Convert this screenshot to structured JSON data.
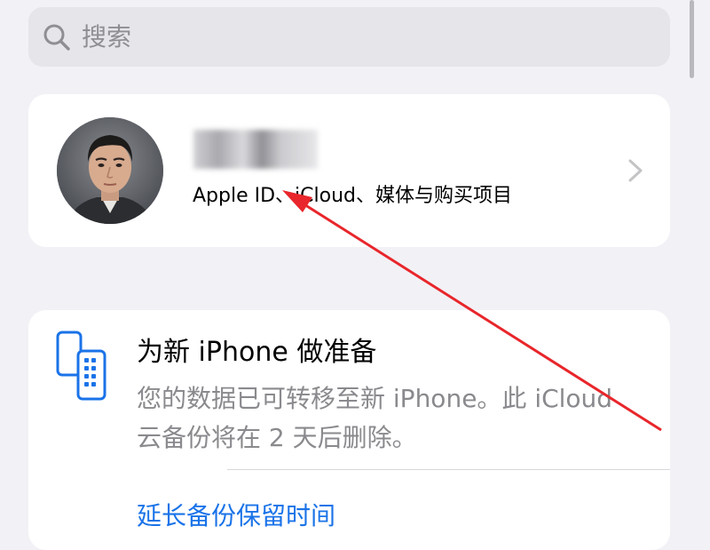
{
  "search": {
    "placeholder": "搜索",
    "icon": "search-icon"
  },
  "profile": {
    "subtitle": "Apple ID、iCloud、媒体与购买项目",
    "name_hidden": true,
    "chevron_icon": "chevron-right-icon"
  },
  "backup_card": {
    "title": "为新 iPhone 做准备",
    "description": "您的数据已可转移至新 iPhone。此 iCloud 云备份将在 2 天后删除。",
    "link_label": "延长备份保留时间",
    "icon": "phone-transfer-icon"
  },
  "colors": {
    "background": "#f2f1f6",
    "link": "#1a73e8",
    "annotation_arrow": "#e8262b",
    "secondary_text": "#8a8a8e"
  }
}
